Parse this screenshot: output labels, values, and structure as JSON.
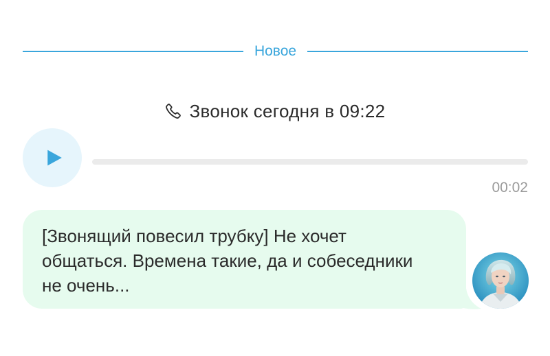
{
  "divider": {
    "label": "Новое"
  },
  "call": {
    "title": "Звонок сегодня в 09:22",
    "icon": "phone-icon"
  },
  "player": {
    "icon": "play-icon",
    "duration": "00:02",
    "progress": 0
  },
  "message": {
    "text": "[Звонящий повесил трубку] Не хочет общаться. Времена такие, да и собеседники не очень..."
  },
  "colors": {
    "accent": "#3aa6dc",
    "bubble": "#e6fbee",
    "play_bg": "#e6f5fc",
    "track": "#ebebeb",
    "muted": "#9a9a9a"
  }
}
